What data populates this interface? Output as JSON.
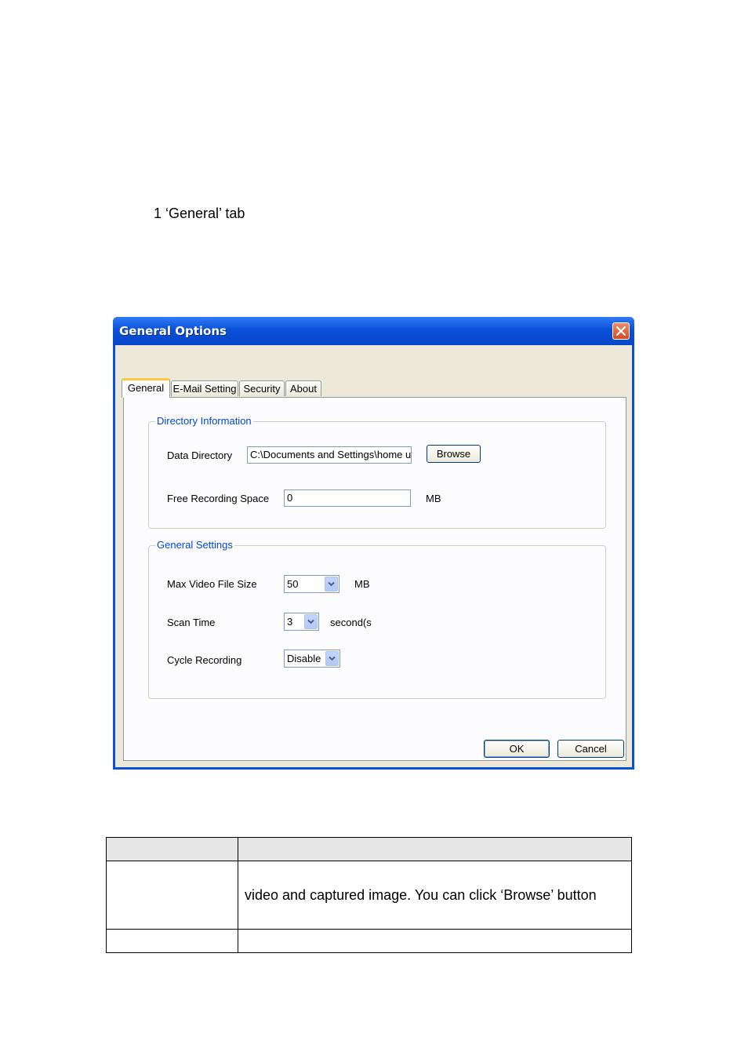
{
  "caption": "1 ‘General’ tab",
  "dialog": {
    "title": "General Options",
    "tabs": [
      {
        "label": "General",
        "active": true
      },
      {
        "label": "E-Mail Setting",
        "active": false
      },
      {
        "label": "Security",
        "active": false
      },
      {
        "label": "About",
        "active": false
      }
    ],
    "directory_group": {
      "title": "Directory Information",
      "data_directory_label": "Data Directory",
      "data_directory_value": "C:\\Documents and Settings\\home u:",
      "browse_label": "Browse",
      "free_space_label": "Free Recording Space",
      "free_space_value": "0",
      "free_space_unit": "MB"
    },
    "general_group": {
      "title": "General Settings",
      "max_size_label": "Max Video File Size",
      "max_size_value": "50",
      "max_size_unit": "MB",
      "scan_time_label": "Scan Time",
      "scan_time_value": "3",
      "scan_time_unit": "second(s)",
      "cycle_label": "Cycle Recording",
      "cycle_value": "Disable"
    },
    "ok_label": "OK",
    "cancel_label": "Cancel",
    "colors": {
      "title_bar": "#0a50d8",
      "close_button": "#d64b21",
      "group_title": "#0046d5",
      "active_tab_accent": "#ffc83c"
    }
  },
  "table": {
    "header": [
      "",
      ""
    ],
    "row1": [
      "",
      "video and captured image. You can click ‘Browse’ button"
    ],
    "row2": [
      "",
      ""
    ]
  }
}
